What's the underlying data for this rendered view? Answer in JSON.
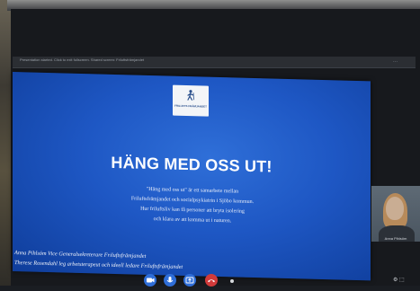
{
  "meeting": {
    "bar_text": "Presentation started. Click to exit fullscreen. Shared screen: Friluftsfrämjandet",
    "bar_controls": "···"
  },
  "slide": {
    "logo_text": "FRILUFTS FRÄMJANDET",
    "headline": "HÄNG MED OSS UT!",
    "body_lines": [
      "\"Häng med oss ut\" är ett samarbete mellan",
      "Friluftsfrämjandet och socialpsykiatrin i Sjöbo kommun.",
      "Hur friluftsliv kan få personer att bryta isolering",
      "och klara av att komma ut i naturen."
    ],
    "credits": [
      "Anna Pihlsöm Vice Generalsekreterare Friluftsfrämjandet",
      "Therese Rosendahl leg arbetsterapeut och ideell ledare Friluftsfrämjandet"
    ]
  },
  "participant": {
    "name": "Anna Pihlsöm"
  },
  "toolbar": {
    "right_label": "⚙ ⬚"
  },
  "colors": {
    "slide_blue": "#1e57c4",
    "toolbar_blue": "#2f6ed8",
    "leave_red": "#d13a3a"
  },
  "icons": [
    "camera-icon",
    "microphone-icon",
    "share-screen-icon",
    "leave-call-icon",
    "more-options-icon"
  ]
}
